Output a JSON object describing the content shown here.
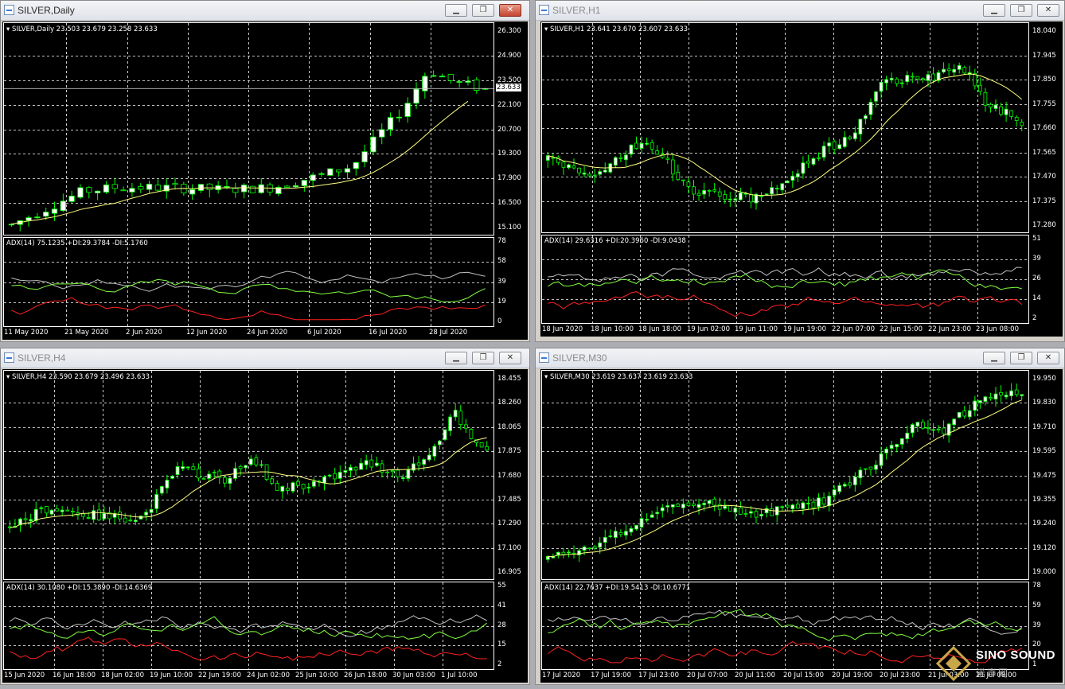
{
  "windows": [
    {
      "id": "daily",
      "title": "SILVER,Daily",
      "active": true,
      "header": "SILVER,Daily  23.503 23.679 23.258 23.633",
      "indicator_label": "ADX(14) 75.1235 +DI:29.3784 -DI:5.1760",
      "price_axis": [
        "26.300",
        "24.900",
        "23.500",
        "22.100",
        "20.700",
        "19.300",
        "17.900",
        "16.500",
        "15.100"
      ],
      "price_tag": "23.633",
      "adx_axis": [
        "78",
        "58",
        "39",
        "19",
        "0"
      ],
      "time_axis": [
        "11 May 2020",
        "21 May 2020",
        "2 Jun 2020",
        "12 Jun 2020",
        "24 Jun 2020",
        "6 Jul 2020",
        "16 Jul 2020",
        "28 Jul 2020"
      ]
    },
    {
      "id": "h1",
      "title": "SILVER,H1",
      "active": false,
      "header": "SILVER,H1  23.641 23.670 23.607 23.633",
      "indicator_label": "ADX(14) 29.6316 +DI:20.3960 -DI:9.0438",
      "price_axis": [
        "18.040",
        "17.945",
        "17.850",
        "17.755",
        "17.660",
        "17.565",
        "17.470",
        "17.375",
        "17.280"
      ],
      "adx_axis": [
        "51",
        "39",
        "26",
        "14",
        "2"
      ],
      "time_axis": [
        "18 Jun 2020",
        "18 Jun 10:00",
        "18 Jun 18:00",
        "19 Jun 02:00",
        "19 Jun 11:00",
        "19 Jun 19:00",
        "22 Jun 07:00",
        "22 Jun 15:00",
        "22 Jun 23:00",
        "23 Jun 08:00"
      ]
    },
    {
      "id": "h4",
      "title": "SILVER,H4",
      "active": false,
      "header": "SILVER,H4  23.590 23.679 23.496 23.633",
      "indicator_label": "ADX(14) 30.1080 +DI:15.3890 -DI:14.6369",
      "price_axis": [
        "18.455",
        "18.260",
        "18.065",
        "17.875",
        "17.680",
        "17.485",
        "17.290",
        "17.100",
        "16.905"
      ],
      "adx_axis": [
        "55",
        "41",
        "28",
        "15",
        "2"
      ],
      "time_axis": [
        "15 Jun 2020",
        "16 Jun 18:00",
        "18 Jun 02:00",
        "19 Jun 10:00",
        "22 Jun 19:00",
        "24 Jun 02:00",
        "25 Jun 10:00",
        "26 Jun 18:00",
        "30 Jun 03:00",
        "1 Jul 10:00"
      ]
    },
    {
      "id": "m30",
      "title": "SILVER,M30",
      "active": false,
      "header": "SILVER,M30  23.619 23.637 23.619 23.633",
      "indicator_label": "ADX(14) 22.7637 +DI:19.5413 -DI:10.6771",
      "price_axis": [
        "19.950",
        "19.830",
        "19.710",
        "19.595",
        "19.475",
        "19.355",
        "19.240",
        "19.120",
        "19.000"
      ],
      "adx_axis": [
        "78",
        "59",
        "39",
        "20",
        "1"
      ],
      "time_axis": [
        "17 Jul 2020",
        "17 Jul 19:00",
        "17 Jul 23:00",
        "20 Jul 07:00",
        "20 Jul 11:00",
        "20 Jul 15:00",
        "20 Jul 19:00",
        "20 Jul 23:00",
        "21 Jul 03:00",
        "21 Jul 08:00"
      ]
    }
  ],
  "colors": {
    "bull_candle": "#ffffff",
    "candle_outline": "#00ff00",
    "moving_average": "#ffff80",
    "adx_line": "#c0c0c0",
    "plus_di": "#80ff40",
    "minus_di": "#ff2020",
    "grid": "#ffffff",
    "background": "#000000"
  },
  "watermark": {
    "brand": "SINO SOUND",
    "sub": "诺声网"
  }
}
